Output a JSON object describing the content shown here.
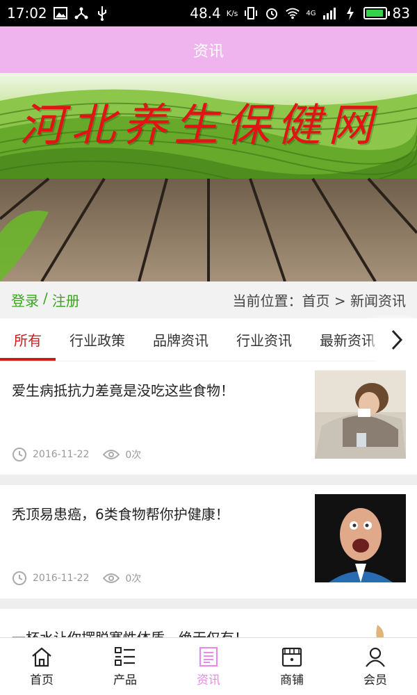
{
  "status_bar": {
    "time": "17:02",
    "network_speed": "48.4",
    "speed_unit": "K/s",
    "network_type": "4G",
    "battery_level": "83"
  },
  "header": {
    "title": "资讯"
  },
  "banner": {
    "title": "河北养生保健网"
  },
  "location_bar": {
    "login_label": "登录",
    "separator": "/",
    "register_label": "注册",
    "location_text": "当前位置：首页 > 新闻资讯"
  },
  "tabs": [
    {
      "label": "所有",
      "active": true
    },
    {
      "label": "行业政策"
    },
    {
      "label": "品牌资讯"
    },
    {
      "label": "行业资讯"
    },
    {
      "label": "最新资讯"
    }
  ],
  "articles": [
    {
      "title": "爱生病抵抗力差竟是没吃这些食物！",
      "date": "2016-11-22",
      "views": "0次"
    },
    {
      "title": "秃顶易患癌，6类食物帮你护健康！",
      "date": "2016-11-22",
      "views": "0次"
    },
    {
      "title": "一杯水让你摆脱寒性体质，绝无仅有！",
      "date": "",
      "views": ""
    }
  ],
  "bottom_nav": [
    {
      "label": "首页",
      "icon": "home-icon"
    },
    {
      "label": "产品",
      "icon": "list-icon"
    },
    {
      "label": "资讯",
      "icon": "news-icon",
      "active": true
    },
    {
      "label": "商铺",
      "icon": "store-icon"
    },
    {
      "label": "会员",
      "icon": "user-icon"
    }
  ],
  "colors": {
    "header": "#efb4ee",
    "accent": "#d11a1a",
    "nav_active": "#e78be6",
    "login": "#3aa51f"
  }
}
